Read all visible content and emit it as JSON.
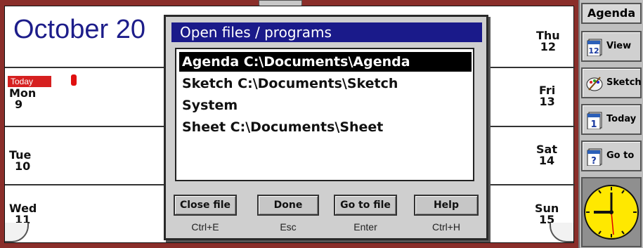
{
  "calendar": {
    "month_heading": "October 20",
    "today_badge": "Today",
    "left_days": [
      {
        "name": "Mon",
        "num": "9"
      },
      {
        "name": "Tue",
        "num": "10"
      },
      {
        "name": "Wed",
        "num": "11"
      }
    ],
    "right_days": [
      {
        "name": "Thu",
        "num": "12"
      },
      {
        "name": "Fri",
        "num": "13"
      },
      {
        "name": "Sat",
        "num": "14"
      },
      {
        "name": "Sun",
        "num": "15"
      }
    ]
  },
  "dialog": {
    "title": "Open files / programs",
    "items": [
      {
        "label": "Agenda C:\\Documents\\Agenda",
        "selected": true
      },
      {
        "label": "Sketch C:\\Documents\\Sketch",
        "selected": false
      },
      {
        "label": "System",
        "selected": false
      },
      {
        "label": "Sheet C:\\Documents\\Sheet",
        "selected": false
      }
    ],
    "buttons": [
      {
        "label": "Close file",
        "shortcut": "Ctrl+E"
      },
      {
        "label": "Done",
        "shortcut": "Esc"
      },
      {
        "label": "Go to file",
        "shortcut": "Enter"
      },
      {
        "label": "Help",
        "shortcut": "Ctrl+H"
      }
    ]
  },
  "sidebar": {
    "title": "Agenda",
    "buttons": [
      {
        "label": "View",
        "icon": "calendar-12-icon"
      },
      {
        "label": "Sketch",
        "icon": "sketch-palette-icon"
      },
      {
        "label": "Today",
        "icon": "calendar-1-icon"
      },
      {
        "label": "Go to",
        "icon": "calendar-question-icon"
      }
    ],
    "calendar_icon_digits": [
      "12",
      "1",
      "?"
    ]
  },
  "colors": {
    "frame": "#8a2e2a",
    "title_bar": "#1a1a8a",
    "heading": "#1d1d8a",
    "today_badge": "#d62020",
    "clock_face": "#ffe800"
  }
}
